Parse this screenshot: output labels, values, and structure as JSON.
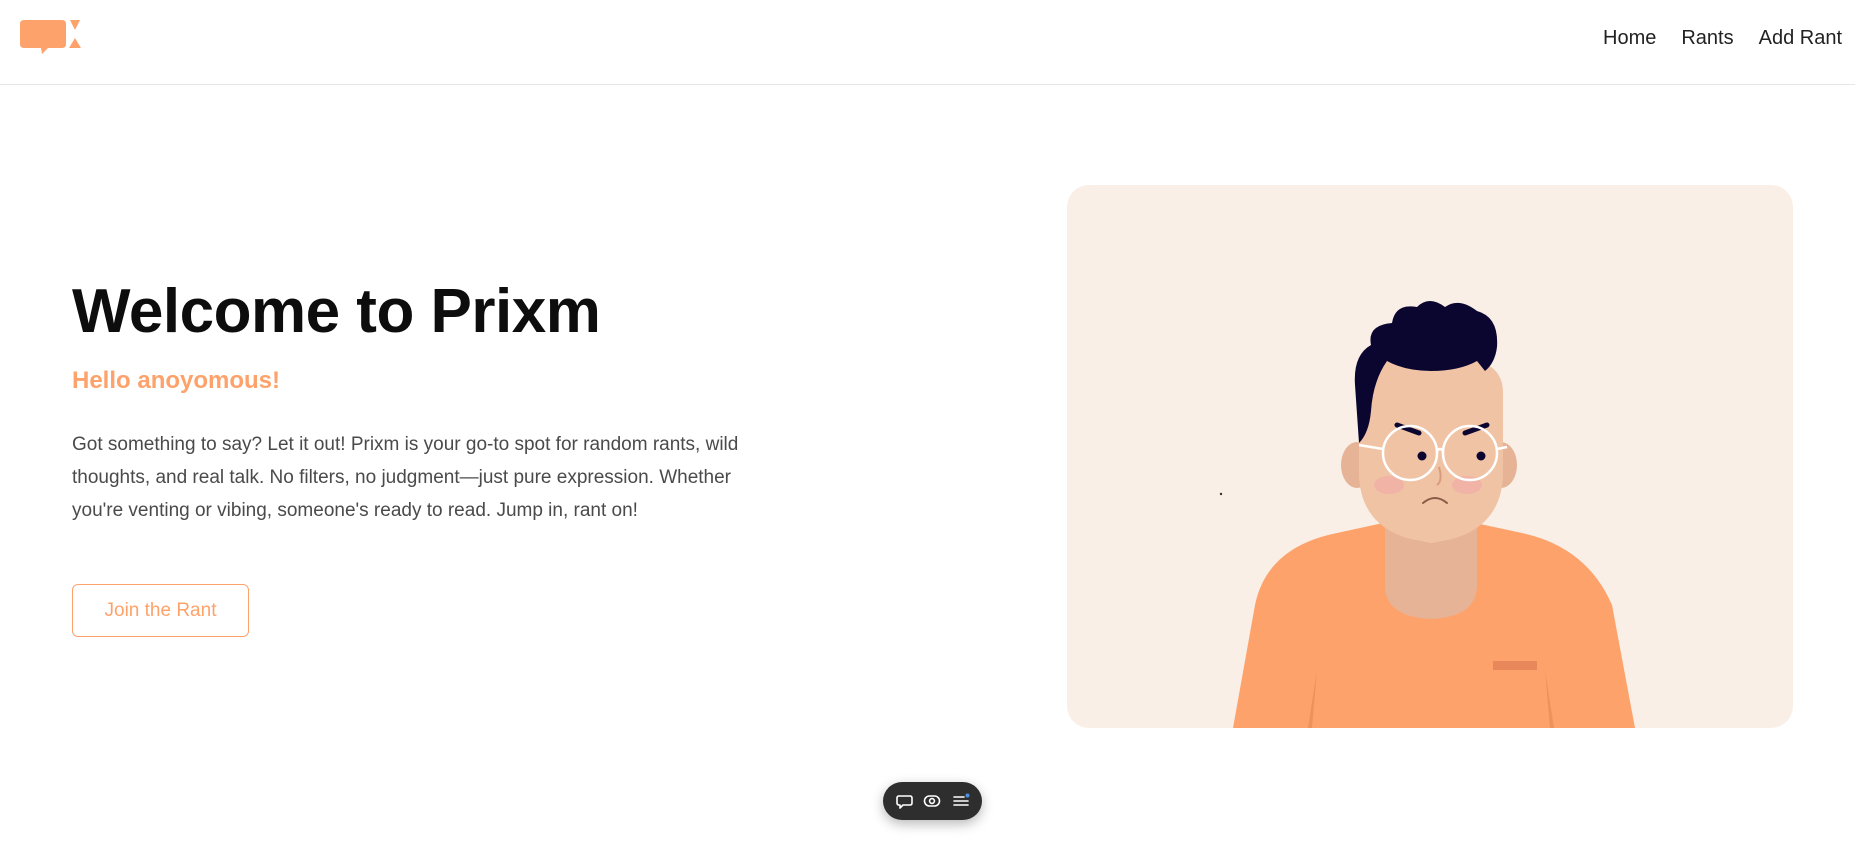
{
  "brand": {
    "accent": "#fea26b",
    "logo_icon": "speech-bubble-x-logo"
  },
  "nav": {
    "items": [
      {
        "label": "Home"
      },
      {
        "label": "Rants"
      },
      {
        "label": "Add Rant"
      }
    ]
  },
  "hero": {
    "title": "Welcome to Prixm",
    "greeting": "Hello anoyomous!",
    "description": "Got something to say? Let it out! Prixm is your go-to spot for random rants, wild thoughts, and real talk. No filters, no judgment—just pure expression. Whether you're venting or vibing, someone's ready to read. Jump in, rant on!",
    "cta_label": "Join the Rant"
  },
  "illustration": {
    "subject": "man-with-glasses-illustration",
    "background": "#f9efe6",
    "shirt_color": "#fea26b",
    "skin_color": "#e6b396",
    "hair_color": "#0b0630"
  },
  "floating_toolbar": {
    "icons": [
      "comment-icon",
      "eye-icon",
      "menu-icon"
    ],
    "notification_dot_color": "#4a8fe0"
  }
}
